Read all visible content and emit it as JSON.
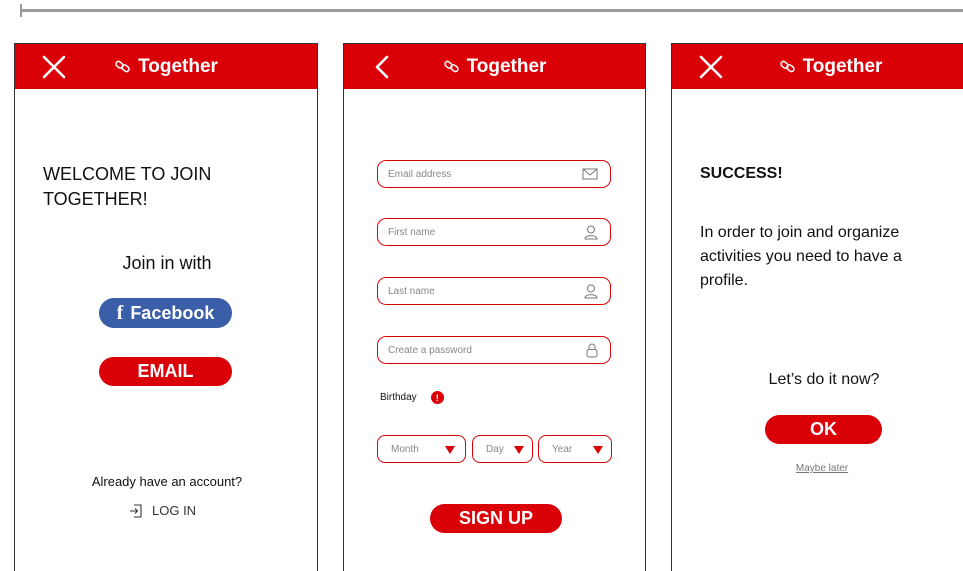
{
  "brand": {
    "name": "Together",
    "accent": "#d90008",
    "facebook_color": "#3a5ea8"
  },
  "screen1": {
    "nav_icon": "close-icon",
    "welcome": "WELCOME TO JOIN TOGETHER!",
    "join_with": "Join in with",
    "facebook_label": "Facebook",
    "facebook_glyph": "f",
    "email_label": "EMAIL",
    "already": "Already have an account?",
    "login_label": "LOG IN",
    "login_icon": "login-icon"
  },
  "screen2": {
    "nav_icon": "back-arrow-icon",
    "fields": [
      {
        "placeholder": "Email address",
        "icon": "mail-icon"
      },
      {
        "placeholder": "First name",
        "icon": "user-icon"
      },
      {
        "placeholder": "Last name",
        "icon": "user-icon"
      },
      {
        "placeholder": "Create a password",
        "icon": "lock-icon"
      }
    ],
    "birthday_label": "Birthday",
    "birthday_info": "!",
    "selects": {
      "month": "Month",
      "day": "Day",
      "year": "Year"
    },
    "signup_label": "SIGN UP"
  },
  "screen3": {
    "nav_icon": "close-icon",
    "success": "SUCCESS!",
    "message": "In order to join and organize activities you need to have a profile.",
    "prompt": "Let’s do it now?",
    "ok_label": "OK",
    "maybe_label": "Maybe later"
  }
}
